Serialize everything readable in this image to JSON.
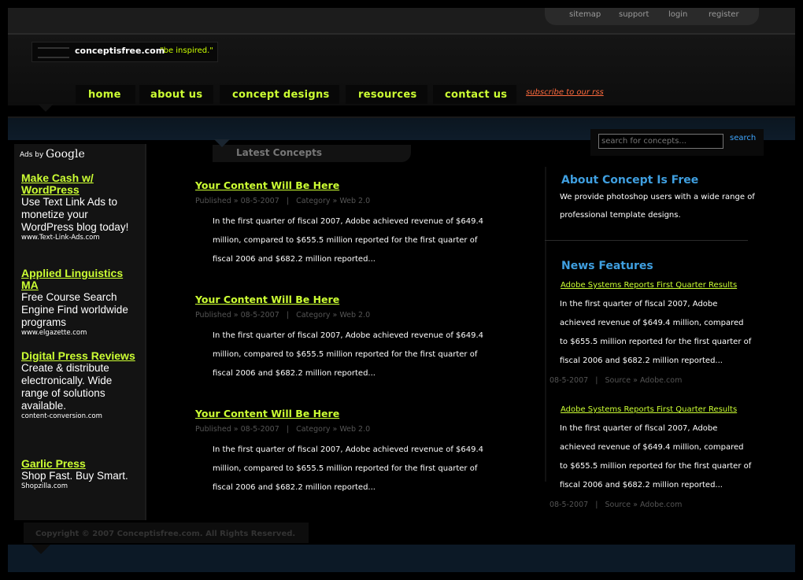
{
  "top_links": [
    "sitemap",
    "support",
    "login",
    "register"
  ],
  "logo": {
    "name": "conceptisfree.com",
    "tagline": "\"be inspired.\""
  },
  "nav": {
    "items": [
      "home",
      "about us",
      "concept designs",
      "resources",
      "contact us"
    ],
    "rss_label": "subscribe to our rss"
  },
  "search": {
    "placeholder": "search for concepts...",
    "button": "search"
  },
  "ads": {
    "ads_by": "Ads by",
    "google": "Google",
    "items": [
      {
        "title": "Make Cash w/ WordPress",
        "body": "Use Text Link Ads to monetize your WordPress blog today!",
        "url": "www.Text-Link-Ads.com"
      },
      {
        "title": "Applied Linguistics MA",
        "body": "Free Course Search Engine Find worldwide programs",
        "url": "www.elgazette.com"
      },
      {
        "title": "Digital Press Reviews",
        "body": "Create & distribute electronically. Wide range of solutions available.",
        "url": "content-conversion.com"
      },
      {
        "title": "Garlic Press",
        "body": "Shop Fast. Buy Smart.",
        "url": "Shopzilla.com"
      }
    ]
  },
  "latest": {
    "heading": "Latest Concepts",
    "posts": [
      {
        "title": "Your Content Will Be Here",
        "meta": "Published » 08-5-2007   |   Category » Web 2.0",
        "body": "In the first quarter of fiscal 2007, Adobe achieved revenue of $649.4 million, compared to $655.5 million reported for the first quarter of fiscal 2006 and $682.2 million reported..."
      },
      {
        "title": "Your Content Will Be Here",
        "meta": "Published » 08-5-2007   |   Category » Web 2.0",
        "body": "In the first quarter of fiscal 2007, Adobe achieved revenue of $649.4 million, compared to $655.5 million reported for the first quarter of fiscal 2006 and $682.2 million reported..."
      },
      {
        "title": "Your Content Will Be Here",
        "meta": "Published » 08-5-2007   |   Category » Web 2.0",
        "body": "In the first quarter of fiscal 2007, Adobe achieved revenue of $649.4 million, compared to $655.5 million reported for the first quarter of fiscal 2006 and $682.2 million reported..."
      }
    ]
  },
  "about": {
    "heading": "About Concept Is Free",
    "body": "We provide photoshop users with a wide range of professional template designs."
  },
  "news": {
    "heading": "News Features",
    "items": [
      {
        "title": "Adobe Systems Reports First Quarter Results",
        "body": "In the first quarter of fiscal 2007, Adobe achieved revenue of $649.4 million, compared to $655.5 million reported for the first quarter of fiscal 2006 and $682.2 million reported...",
        "meta": "08-5-2007   |   Source » Adobe.com"
      },
      {
        "title": "Adobe Systems Reports First Quarter Results",
        "body": "In the first quarter of fiscal 2007, Adobe achieved revenue of $649.4 million, compared to $655.5 million reported for the first quarter of fiscal 2006 and $682.2 million reported...",
        "meta": "08-5-2007   |   Source » Adobe.com"
      }
    ]
  },
  "footer": {
    "copyright": "Copyright © 2007 Conceptisfree.com. All Rights Reserved."
  }
}
